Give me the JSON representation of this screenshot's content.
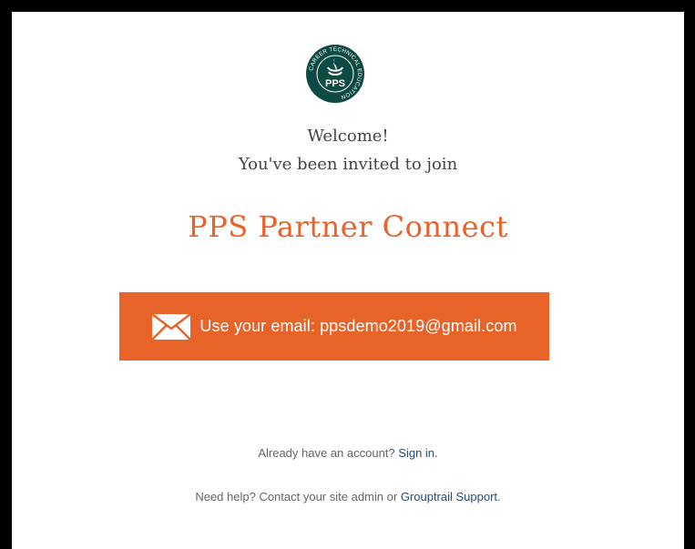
{
  "logo": {
    "icon": "pps-cte-logo-icon",
    "ring_text": "CAREER TECHNICAL EDUCATION",
    "monogram": "PPS",
    "color": "#0e4a44"
  },
  "welcome": "Welcome!",
  "invited": "You've been invited to join",
  "title": "PPS Partner Connect",
  "email_button": {
    "icon": "envelope-icon",
    "label": "Use your email: ppsdemo2019@gmail.com",
    "color": "#e86328"
  },
  "signin": {
    "prompt": "Already have an account?",
    "link": "Sign in."
  },
  "help": {
    "prompt": "Need help? Contact your site admin or",
    "link": "Grouptrail Support",
    "suffix": "."
  },
  "colors": {
    "accent": "#e8622a",
    "link": "#1f4f7a",
    "frame": "#000000"
  }
}
